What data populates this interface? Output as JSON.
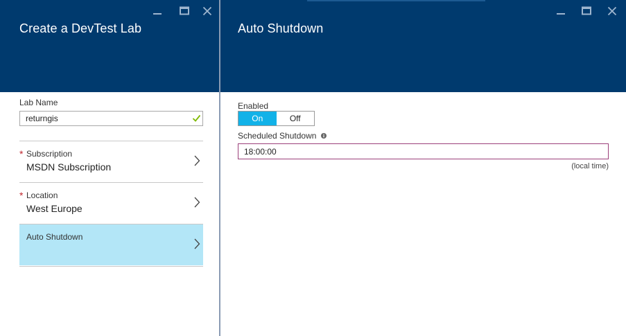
{
  "left_blade": {
    "title": "Create a DevTest Lab",
    "lab_name": {
      "label": "Lab Name",
      "value": "returngis"
    },
    "subscription": {
      "label": "Subscription",
      "value": "MSDN Subscription",
      "required_mark": "*"
    },
    "location": {
      "label": "Location",
      "value": "West Europe",
      "required_mark": "*"
    },
    "auto_shutdown": {
      "label": "Auto Shutdown"
    }
  },
  "right_blade": {
    "title": "Auto Shutdown",
    "enabled": {
      "label": "Enabled",
      "on": "On",
      "off": "Off",
      "selected": "On"
    },
    "scheduled_shutdown": {
      "label": "Scheduled Shutdown",
      "value": "18:00:00",
      "hint": "(local time)"
    }
  },
  "colors": {
    "header": "#003a6e",
    "accent": "#12b2e8",
    "selected_item": "#b3e6f7",
    "required": "#c0262d",
    "valid_check": "#7fba00",
    "focus_border": "#9b3f7a"
  },
  "icons": {
    "minimize": "minimize-icon",
    "maximize": "maximize-icon",
    "close": "close-icon",
    "check": "check-icon",
    "chevron": "chevron-right-icon",
    "info": "info-icon"
  }
}
